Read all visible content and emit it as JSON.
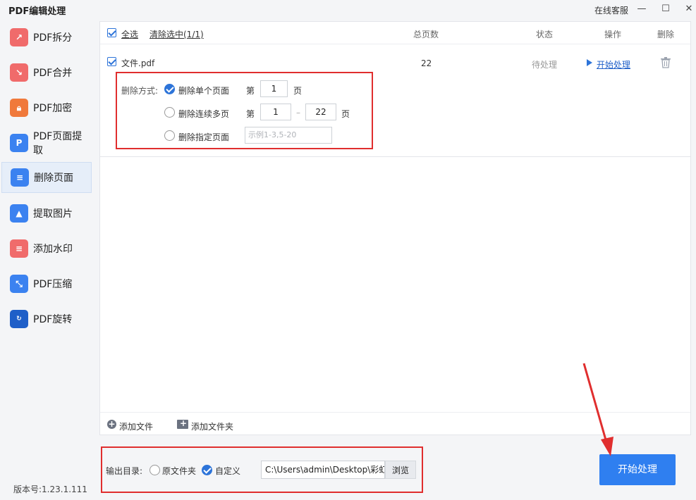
{
  "app": {
    "title": "PDF编辑处理",
    "service": "在线客服"
  },
  "window": {
    "minimize": "—",
    "maximize": "☐",
    "close": "✕"
  },
  "sidebar": {
    "items": [
      {
        "label": "PDF拆分",
        "icon": "split-icon",
        "color": "#f06b6b"
      },
      {
        "label": "PDF合并",
        "icon": "merge-icon",
        "color": "#f06b6b"
      },
      {
        "label": "PDF加密",
        "icon": "lock-icon",
        "color": "#f0793b"
      },
      {
        "label": "PDF页面提取",
        "icon": "page-extract-icon",
        "color": "#3b82f0"
      },
      {
        "label": "删除页面",
        "icon": "delete-page-icon",
        "color": "#3b82f0"
      },
      {
        "label": "提取图片",
        "icon": "image-extract-icon",
        "color": "#3b82f0"
      },
      {
        "label": "添加水印",
        "icon": "watermark-icon",
        "color": "#f06b6b"
      },
      {
        "label": "PDF压缩",
        "icon": "compress-icon",
        "color": "#3b82f0"
      },
      {
        "label": "PDF旋转",
        "icon": "rotate-icon",
        "color": "#1f5fc8"
      }
    ],
    "active_index": 4
  },
  "version": "版本号:1.23.1.111",
  "table": {
    "select_all": "全选",
    "clear_selected": "清除选中(1/1)",
    "col_pages": "总页数",
    "col_status": "状态",
    "col_action": "操作",
    "col_delete": "删除",
    "row": {
      "filename": "文件.pdf",
      "pages": "22",
      "status": "待处理",
      "action": "开始处理"
    }
  },
  "options": {
    "mode_label": "删除方式:",
    "single": {
      "label": "删除单个页面",
      "prefix": "第",
      "value": "1",
      "suffix": "页"
    },
    "range": {
      "label": "删除连续多页",
      "prefix": "第",
      "from": "1",
      "dash": "–",
      "to": "22",
      "suffix": "页"
    },
    "specific": {
      "label": "删除指定页面",
      "placeholder": "示例1-3,5-20"
    }
  },
  "footer": {
    "add_file": "添加文件",
    "add_folder": "添加文件夹"
  },
  "output": {
    "label": "输出目录:",
    "original": "原文件夹",
    "custom": "自定义",
    "path": "C:\\Users\\admin\\Desktop\\彩虹",
    "browse": "浏览"
  },
  "start_button": "开始处理",
  "colors": {
    "accent": "#2f7ff0",
    "highlight": "#e02e2e"
  }
}
